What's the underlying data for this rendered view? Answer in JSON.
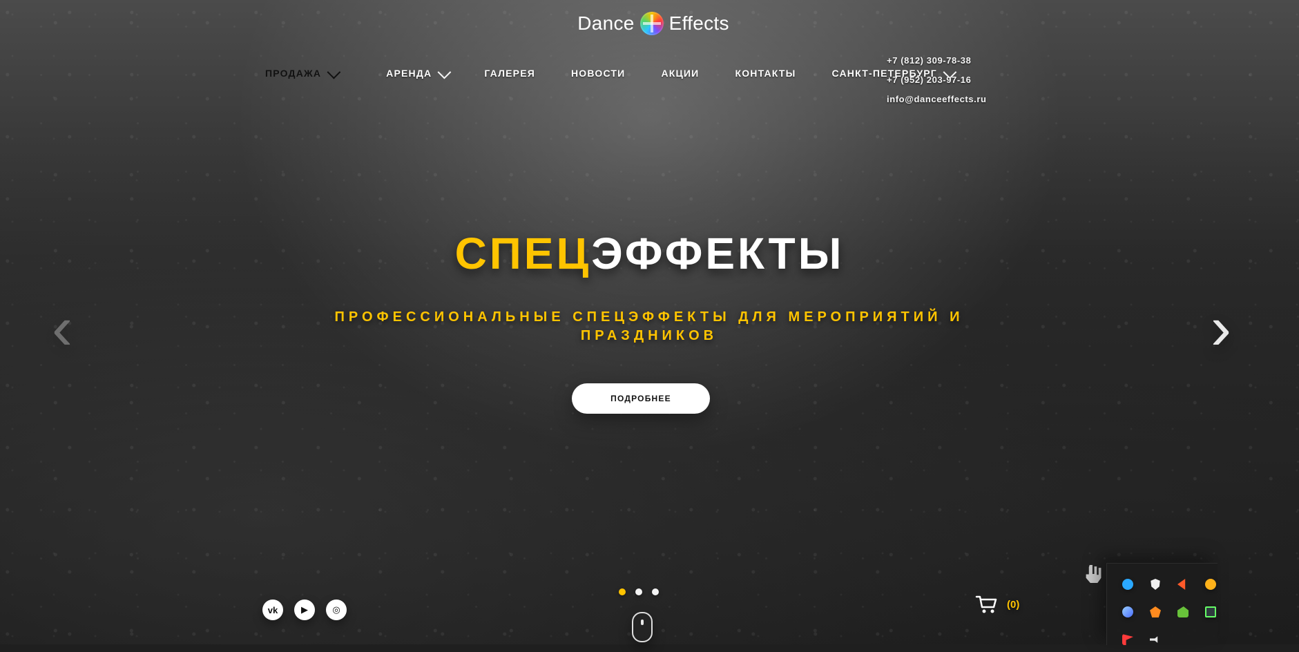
{
  "brand": {
    "left": "Dance",
    "right": "Effects",
    "logo_icon": "dance-effects-logo"
  },
  "nav": {
    "items": [
      {
        "label": "ПРОДАЖА",
        "has_dropdown": true,
        "active": true
      },
      {
        "label": "АРЕНДА",
        "has_dropdown": true,
        "active": false
      },
      {
        "label": "ГАЛЕРЕЯ",
        "has_dropdown": false,
        "active": false
      },
      {
        "label": "НОВОСТИ",
        "has_dropdown": false,
        "active": false
      },
      {
        "label": "АКЦИИ",
        "has_dropdown": false,
        "active": false
      },
      {
        "label": "КОНТАКТЫ",
        "has_dropdown": false,
        "active": false
      },
      {
        "label": "САНКТ-ПЕТЕРБУРГ",
        "has_dropdown": true,
        "active": false
      }
    ]
  },
  "contacts": {
    "phone1": "+7 (812) 309-78-38",
    "phone2": "+7 (952) 203-97-16",
    "email": "info@danceeffects.ru"
  },
  "hero": {
    "title_accent": "СПЕЦ",
    "title_rest": "ЭФФЕКТЫ",
    "subtitle": "ПРОФЕССИОНАЛЬНЫЕ СПЕЦЭФФЕКТЫ ДЛЯ МЕРОПРИЯТИЙ И ПРАЗДНИКОВ",
    "cta_label": "ПОДРОБНЕЕ",
    "slider": {
      "active_index": 0,
      "count": 3
    }
  },
  "social": [
    {
      "name": "vk",
      "icon": "vk-icon",
      "label": "vk"
    },
    {
      "name": "youtube",
      "icon": "youtube-icon",
      "label": "▶"
    },
    {
      "name": "instagram",
      "icon": "instagram-icon",
      "label": "◎"
    }
  ],
  "cart": {
    "count_label": "(0)"
  },
  "colors": {
    "accent": "#ffc400",
    "text": "#ffffff",
    "button_bg": "#ffffff",
    "button_text": "#111111"
  },
  "tray": {
    "icons": [
      "bluetooth-icon",
      "shield-icon",
      "triangle-alert-icon",
      "orange-circle-icon",
      "globe-icon",
      "box-icon",
      "nvidia-icon",
      "monitor-icon",
      "flag-icon",
      "speaker-icon"
    ]
  }
}
